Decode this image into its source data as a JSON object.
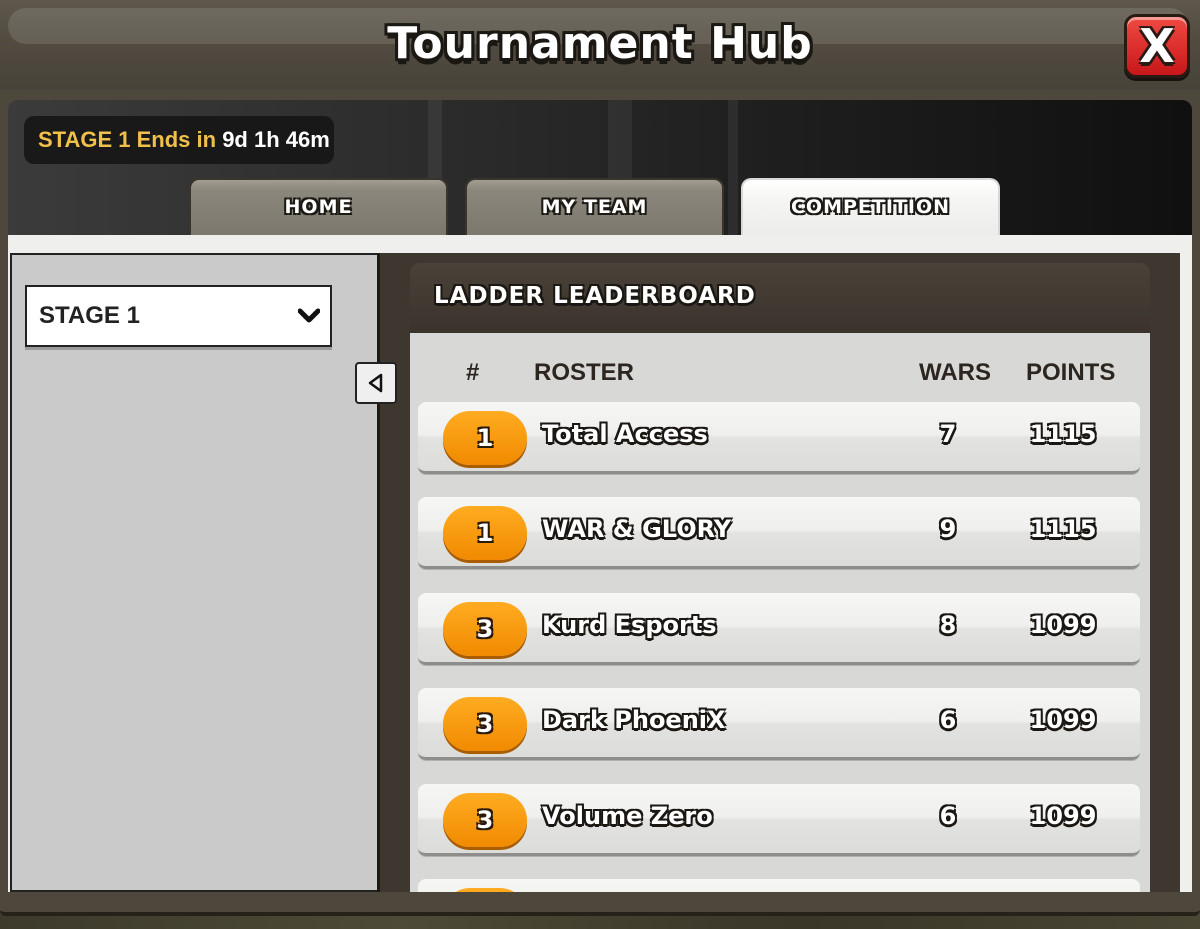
{
  "window": {
    "title": "Tournament Hub",
    "close_label": "X"
  },
  "stage_info": {
    "label": "STAGE 1 Ends in",
    "time_remaining": "9d 1h 46m"
  },
  "tabs": [
    {
      "label": "HOME",
      "active": false
    },
    {
      "label": "MY TEAM",
      "active": false
    },
    {
      "label": "COMPETITION",
      "active": true
    }
  ],
  "stage_select": {
    "value": "STAGE 1"
  },
  "leaderboard": {
    "title": "LADDER LEADERBOARD",
    "columns": {
      "rank": "#",
      "roster": "ROSTER",
      "wars": "WARS",
      "points": "POINTS"
    },
    "rows": [
      {
        "rank": "1",
        "name": "Total Access",
        "wars": "7",
        "points": "1115"
      },
      {
        "rank": "1",
        "name": "WAR & GLORY",
        "wars": "9",
        "points": "1115"
      },
      {
        "rank": "3",
        "name": "Kurd Esports",
        "wars": "8",
        "points": "1099"
      },
      {
        "rank": "3",
        "name": "Dark PhoeniX",
        "wars": "6",
        "points": "1099"
      },
      {
        "rank": "3",
        "name": "Volume Zero",
        "wars": "6",
        "points": "1099"
      }
    ]
  },
  "colors": {
    "accent": "#f5930a",
    "stage_label": "#f0c04a",
    "close_button": "#e0262a"
  }
}
